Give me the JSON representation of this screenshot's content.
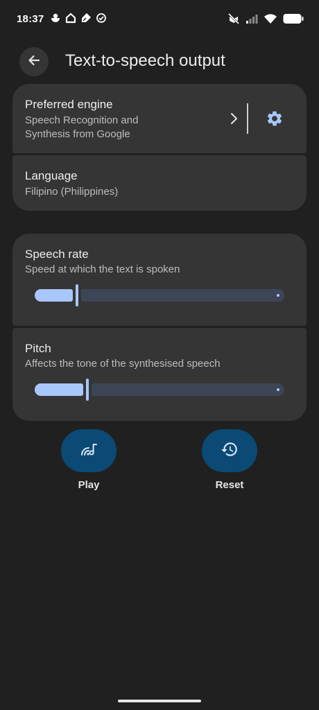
{
  "status_bar": {
    "time": "18:37",
    "left_icons": [
      "chef-hat-icon",
      "home-icon",
      "diamond-pen-icon",
      "check-circle-icon"
    ],
    "right_icons": [
      "vibrate-off-icon",
      "signal-icon",
      "wifi-icon",
      "battery-icon"
    ]
  },
  "header": {
    "title": "Text-to-speech output",
    "back_icon": "arrow-back-icon"
  },
  "engine": {
    "title": "Preferred engine",
    "subtitle_line1": "Speech Recognition and",
    "subtitle_line2": "Synthesis from Google"
  },
  "language": {
    "title": "Language",
    "value": "Filipino (Philippines)"
  },
  "speech_rate": {
    "title": "Speech rate",
    "subtitle": "Speed at which the text is spoken",
    "level": 0.17
  },
  "pitch": {
    "title": "Pitch",
    "subtitle": "Affects the tone of the synthesised speech",
    "level": 0.21
  },
  "actions": {
    "play_label": "Play",
    "reset_label": "Reset"
  },
  "colors": {
    "background": "#202020",
    "card": "#353535",
    "accent": "#a8c7fa",
    "action_button": "#0a4a74",
    "slider_track": "#3c4657"
  }
}
